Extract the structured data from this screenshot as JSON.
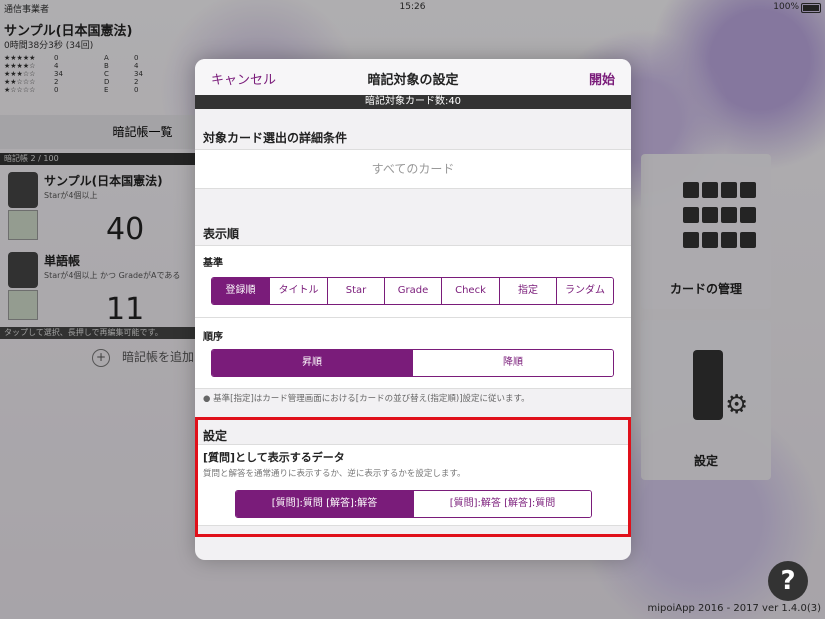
{
  "status_bar": {
    "carrier": "通信事業者",
    "time": "15:26",
    "battery": "100%"
  },
  "left_panel": {
    "deck_title": "サンプル(日本国憲法)",
    "study_time": "0時間38分3秒 (34回)",
    "star_rows": [
      {
        "stars": "★★★★★",
        "count": "0",
        "grade": "A",
        "gcount": "0"
      },
      {
        "stars": "★★★★☆",
        "count": "4",
        "grade": "B",
        "gcount": "4"
      },
      {
        "stars": "★★★☆☆",
        "count": "34",
        "grade": "C",
        "gcount": "34"
      },
      {
        "stars": "★★☆☆☆",
        "count": "2",
        "grade": "D",
        "gcount": "2"
      },
      {
        "stars": "★☆☆☆☆",
        "count": "0",
        "grade": "E",
        "gcount": "0"
      }
    ],
    "list_header": "暗記帳一覧",
    "list_count": "暗記帳 2 / 100",
    "decks": [
      {
        "name": "サンプル(日本国憲法)",
        "condition": "Starが4個以上",
        "count": "40"
      },
      {
        "name": "単語帳",
        "condition": "Starが4個以上 かつ GradeがAである",
        "count": "11"
      }
    ],
    "hint": "タップして選択、長押しで再編集可能です。",
    "add_label": "暗記帳を追加"
  },
  "right_panel": {
    "card_manage_label": "カードの管理",
    "settings_label": "設定"
  },
  "footer": "mipoiApp 2016 - 2017 ver 1.4.0(3)",
  "help_label": "?",
  "modal": {
    "cancel": "キャンセル",
    "title": "暗記対象の設定",
    "start": "開始",
    "card_count": "暗記対象カード数:40",
    "filter_header": "対象カード選出の詳細条件",
    "all_cards": "すべてのカード",
    "display_order_header": "表示順",
    "basis_label": "基準",
    "basis_options": [
      "登録順",
      "タイトル",
      "Star",
      "Grade",
      "Check",
      "指定",
      "ランダム"
    ],
    "basis_selected": 0,
    "order_label": "順序",
    "order_options": [
      "昇順",
      "降順"
    ],
    "order_selected": 0,
    "note": "基準[指定]はカード管理画面における[カードの並び替え(指定順)]設定に従います。",
    "settings_header": "設定",
    "question_data_label": "[質問]として表示するデータ",
    "question_data_desc": "質問と解答を通常通りに表示するか、逆に表示するかを設定します。",
    "display_options": [
      "[質問]:質問 [解答]:解答",
      "[質問]:解答 [解答]:質問"
    ],
    "display_selected": 0
  },
  "colors": {
    "accent": "#7a1c7a",
    "highlight": "#e0101a"
  }
}
